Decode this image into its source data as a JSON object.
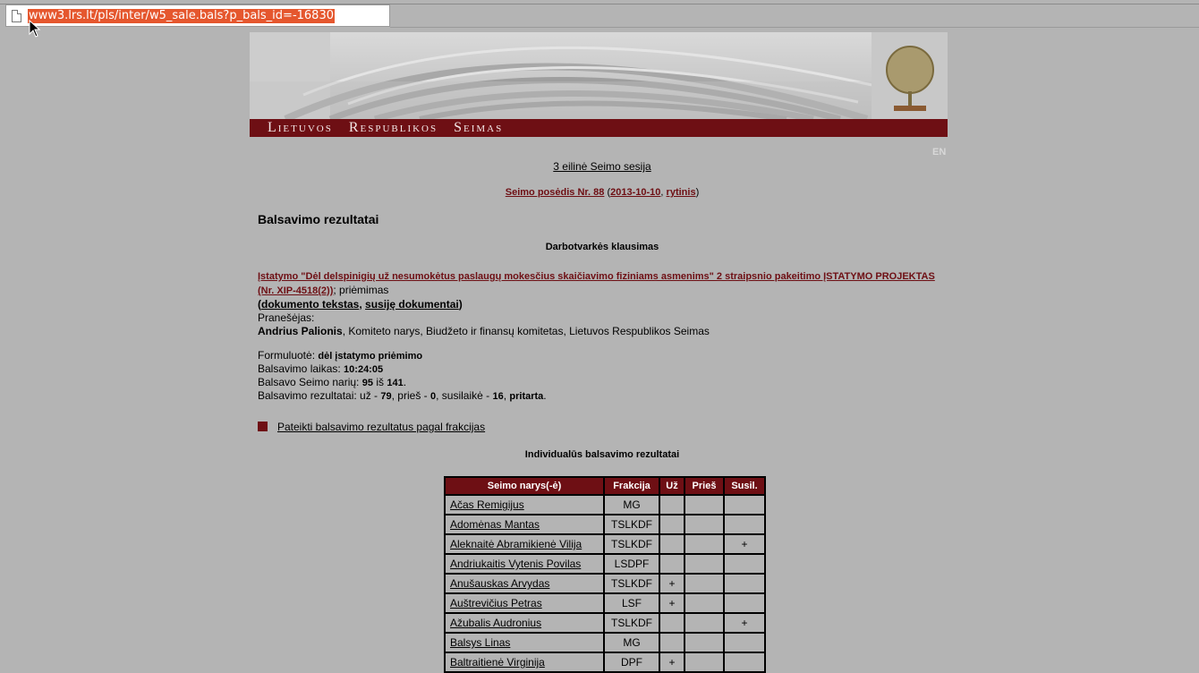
{
  "browser": {
    "url": "www3.lrs.lt/pls/inter/w5_sale.bals?p_bals_id=-16830"
  },
  "banner": {
    "title": "Lietuvos   Respublikos   Seimas"
  },
  "lang_link": "EN",
  "session": "3 eilinė Seimo sesija",
  "sitting": {
    "label": "Seimo posėdis Nr. 88",
    "open": "(",
    "date": "2013-10-10",
    "sep": ",",
    "part": "rytinis",
    "close": ")"
  },
  "heading": "Balsavimo rezultatai",
  "agenda_heading": "Darbotvarkės klausimas",
  "project": {
    "title": "Įstatymo \"Dėl delspinigių už nesumokėtus paslaugų mokesčius skaičiavimo fiziniams asmenims\" 2 straipsnio pakeitimo ĮSTATYMO PROJEKTAS (Nr. XIP-4518(2))",
    "suffix": "; priėmimas",
    "doc_open": "(",
    "doc_text": "dokumento tekstas",
    "doc_sep": ", ",
    "related": "susiję dokumentai",
    "doc_close": ")",
    "speaker_label": "Pranešėjas:",
    "speaker_name": "Andrius Palionis",
    "speaker_role": ", Komiteto narys, Biudžeto ir finansų komitetas, Lietuvos Respublikos Seimas"
  },
  "details": {
    "formulation_label": "Formuluotė: ",
    "formulation": "dėl įstatymo priėmimo",
    "time_label": "Balsavimo laikas: ",
    "time": "10:24:05",
    "voted_label": "Balsavo Seimo narių: ",
    "voted": "95",
    "of": " iš ",
    "total": "141",
    "voted_end": ".",
    "results_label": "Balsavimo rezultatai: už - ",
    "for": "79",
    "against_label": ", prieš - ",
    "against": "0",
    "abstain_label": ", susilaikė - ",
    "abstain": "16",
    "comma": ", ",
    "outcome": "pritarta",
    "end": "."
  },
  "faction_link": "Pateikti balsavimo rezultatus pagal frakcijas",
  "individual_heading": "Individualūs balsavimo rezultatai",
  "table": {
    "headers": [
      "Seimo narys(-ė)",
      "Frakcija",
      "Už",
      "Prieš",
      "Susil."
    ],
    "rows": [
      {
        "name": "Ačas Remigijus",
        "faction": "MG",
        "for": "",
        "against": "",
        "abstain": ""
      },
      {
        "name": "Adomėnas Mantas",
        "faction": "TSLKDF",
        "for": "",
        "against": "",
        "abstain": ""
      },
      {
        "name": "Aleknaitė Abramikienė Vilija",
        "faction": "TSLKDF",
        "for": "",
        "against": "",
        "abstain": "+"
      },
      {
        "name": "Andriukaitis Vytenis Povilas",
        "faction": "LSDPF",
        "for": "",
        "against": "",
        "abstain": ""
      },
      {
        "name": "Anušauskas Arvydas",
        "faction": "TSLKDF",
        "for": "+",
        "against": "",
        "abstain": ""
      },
      {
        "name": "Auštrevičius Petras",
        "faction": "LSF",
        "for": "+",
        "against": "",
        "abstain": ""
      },
      {
        "name": "Ažubalis Audronius",
        "faction": "TSLKDF",
        "for": "",
        "against": "",
        "abstain": "+"
      },
      {
        "name": "Balsys Linas",
        "faction": "MG",
        "for": "",
        "against": "",
        "abstain": ""
      },
      {
        "name": "Baltraitienė Virginija",
        "faction": "DPF",
        "for": "+",
        "against": "",
        "abstain": ""
      }
    ]
  },
  "colors": {
    "background": "#b4b4b4",
    "accent": "#6e0f14",
    "url_highlight": "#e5572e"
  }
}
